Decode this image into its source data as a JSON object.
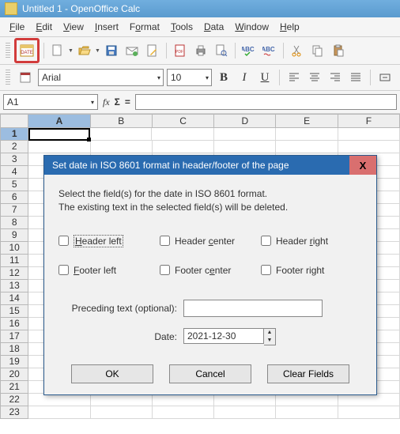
{
  "window": {
    "title": "Untitled 1 - OpenOffice Calc"
  },
  "menu": {
    "file": "File",
    "edit": "Edit",
    "view": "View",
    "insert": "Insert",
    "format": "Format",
    "tools": "Tools",
    "data": "Data",
    "window": "Window",
    "help": "Help"
  },
  "format_bar": {
    "font_name": "Arial",
    "font_size": "10",
    "bold": "B",
    "italic": "I",
    "underline": "U"
  },
  "cell_ref": "A1",
  "fx": "fx",
  "sigma": "Σ",
  "eq": "=",
  "cols": [
    "A",
    "B",
    "C",
    "D",
    "E",
    "F"
  ],
  "rows": [
    "1",
    "2",
    "3",
    "4",
    "5",
    "6",
    "7",
    "8",
    "9",
    "10",
    "11",
    "12",
    "13",
    "14",
    "15",
    "16",
    "17",
    "18",
    "19",
    "20",
    "21",
    "22",
    "23"
  ],
  "dialog": {
    "title": "Set date in ISO 8601 format in header/footer of the page",
    "info1": "Select the field(s) for the date in ISO 8601 format.",
    "info2": "The existing text in the selected field(s) will be deleted.",
    "hl": "Header left",
    "hc": "Header center",
    "hr": "Header right",
    "fl": "Footer left",
    "fc": "Footer center",
    "fr": "Footer right",
    "preceding_label": "Preceding text (optional):",
    "date_label": "Date:",
    "date_value": "2021-12-30",
    "ok": "OK",
    "cancel": "Cancel",
    "clear": "Clear Fields",
    "close": "X"
  }
}
